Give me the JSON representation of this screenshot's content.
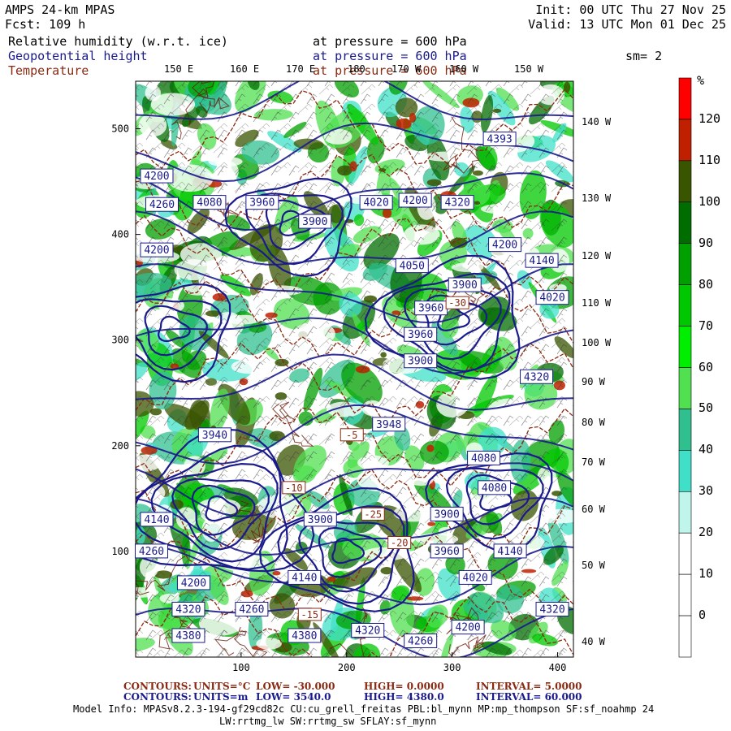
{
  "header": {
    "model": "AMPS 24-km MPAS",
    "forecast": "Fcst:  109 h",
    "init": "Init: 00 UTC Thu 27 Nov 25",
    "valid": "Valid: 13 UTC Mon 01 Dec 25"
  },
  "fields": [
    {
      "name": "Relative humidity (w.r.t. ice)",
      "level": "at pressure =  600 hPa",
      "color": "#000000"
    },
    {
      "name": "Geopotential height",
      "level": "at pressure =  600 hPa",
      "color": "#1a1a8c"
    },
    {
      "name": "Temperature",
      "level": "at pressure =  600 hPa",
      "color": "#8a2a12"
    }
  ],
  "smoothing": "sm= 2",
  "map": {
    "top_lon_labels": [
      "150 E",
      "160 E",
      "170 E",
      "180",
      "170 W",
      "160 W",
      "150 W"
    ],
    "right_lon_labels": [
      "140 W",
      "130 W",
      "120 W",
      "110 W",
      "100 W",
      "90 W",
      "80 W",
      "70 W",
      "60 W",
      "50 W",
      "40 W"
    ],
    "y_ticks": [
      100,
      200,
      300,
      400,
      500
    ],
    "x_ticks": [
      100,
      200,
      300,
      400
    ],
    "x_range": [
      0,
      415
    ],
    "y_range": [
      0,
      545
    ],
    "height_contour_labels": [
      {
        "text": "3960",
        "x": 120,
        "y": 430
      },
      {
        "text": "3900",
        "x": 170,
        "y": 412
      },
      {
        "text": "4020",
        "x": 228,
        "y": 430
      },
      {
        "text": "4200",
        "x": 265,
        "y": 432
      },
      {
        "text": "4320",
        "x": 305,
        "y": 430
      },
      {
        "text": "4260",
        "x": 25,
        "y": 428
      },
      {
        "text": "4080",
        "x": 70,
        "y": 430
      },
      {
        "text": "4200",
        "x": 20,
        "y": 385
      },
      {
        "text": "3960",
        "x": 280,
        "y": 330
      },
      {
        "text": "3900",
        "x": 312,
        "y": 352
      },
      {
        "text": "3960",
        "x": 270,
        "y": 305
      },
      {
        "text": "3900",
        "x": 270,
        "y": 280
      },
      {
        "text": "3940",
        "x": 75,
        "y": 210
      },
      {
        "text": "4140",
        "x": 20,
        "y": 130
      },
      {
        "text": "4260",
        "x": 15,
        "y": 100
      },
      {
        "text": "4200",
        "x": 55,
        "y": 70
      },
      {
        "text": "4320",
        "x": 50,
        "y": 45
      },
      {
        "text": "4380",
        "x": 50,
        "y": 20
      },
      {
        "text": "4260",
        "x": 110,
        "y": 45
      },
      {
        "text": "4140",
        "x": 160,
        "y": 75
      },
      {
        "text": "3900",
        "x": 175,
        "y": 130
      },
      {
        "text": "3960",
        "x": 295,
        "y": 100
      },
      {
        "text": "4020",
        "x": 322,
        "y": 75
      },
      {
        "text": "4140",
        "x": 355,
        "y": 100
      },
      {
        "text": "3900",
        "x": 295,
        "y": 135
      },
      {
        "text": "4320",
        "x": 395,
        "y": 45
      },
      {
        "text": "4200",
        "x": 315,
        "y": 28
      },
      {
        "text": "4320",
        "x": 220,
        "y": 25
      },
      {
        "text": "4260",
        "x": 270,
        "y": 15
      },
      {
        "text": "4380",
        "x": 160,
        "y": 20
      },
      {
        "text": "4080",
        "x": 340,
        "y": 160
      },
      {
        "text": "4320",
        "x": 380,
        "y": 265
      },
      {
        "text": "4080",
        "x": 330,
        "y": 188
      },
      {
        "text": "4140",
        "x": 385,
        "y": 375
      },
      {
        "text": "4020",
        "x": 395,
        "y": 340
      },
      {
        "text": "4200",
        "x": 350,
        "y": 390
      },
      {
        "text": "4050",
        "x": 262,
        "y": 370
      },
      {
        "text": "4393",
        "x": 345,
        "y": 490
      },
      {
        "text": "3948",
        "x": 240,
        "y": 220
      },
      {
        "text": "4200",
        "x": 20,
        "y": 455
      }
    ],
    "temp_contour_labels": [
      {
        "text": "-25",
        "x": 225,
        "y": 135
      },
      {
        "text": "-30",
        "x": 305,
        "y": 335
      },
      {
        "text": "-5",
        "x": 205,
        "y": 210
      },
      {
        "text": "-10",
        "x": 150,
        "y": 160
      },
      {
        "text": "-15",
        "x": 165,
        "y": 40
      },
      {
        "text": "-20",
        "x": 250,
        "y": 108
      }
    ]
  },
  "colorbar": {
    "unit": "%",
    "labels": [
      "120",
      "110",
      "100",
      "90",
      "80",
      "70",
      "60",
      "50",
      "40",
      "30",
      "20",
      "10",
      "0"
    ],
    "colors": [
      "#ff0000",
      "#c02000",
      "#3a5500",
      "#006d00",
      "#00a000",
      "#00c800",
      "#00ee00",
      "#50e050",
      "#30c090",
      "#40e0c8",
      "#c0f5ec",
      "#ffffff",
      "#ffffff",
      "#ffffff"
    ]
  },
  "footer": {
    "temp_contours": {
      "label": "CONTOURS:",
      "units": "UNITS=°C",
      "low": "LOW= -30.000",
      "high": "HIGH=  0.0000",
      "interval": "INTERVAL=   5.0000"
    },
    "height_contours": {
      "label": "CONTOURS:",
      "units": "UNITS=m",
      "low": "LOW=  3540.0",
      "high": "HIGH=  4380.0",
      "interval": "INTERVAL=   60.000"
    },
    "model_info_1": "Model Info: MPASv8.2.3-194-gf29cd82c CU:cu_grell_freitas PBL:bl_mynn MP:mp_thompson SF:sf_noahmp 24",
    "model_info_2": "LW:rrtmg_lw SW:rrtmg_sw SFLAY:sf_mynn"
  },
  "colors": {
    "height": "#1a1a8c",
    "temperature": "#8a2a12",
    "coast": "#6a1a0a"
  }
}
